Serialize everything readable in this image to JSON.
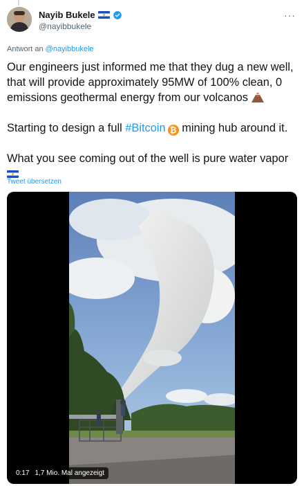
{
  "author": {
    "display_name": "Nayib Bukele",
    "handle": "@nayibbukele",
    "verified_icon": "verified-badge-icon",
    "flag_icon": "el-salvador-flag-icon"
  },
  "reply": {
    "prefix": "Antwort an",
    "target": "@nayibbukele"
  },
  "tweet": {
    "line1": "Our engineers just informed me that they dug a new well, that will provide approximately 95MW of 100% clean, 0 emissions geothermal energy from our volcanos",
    "line2_before": "Starting to design a full",
    "hashtag": "#Bitcoin",
    "line2_after": "mining hub around it.",
    "line3": "What you see coming out of the well is pure water vapor",
    "emoji_icons": [
      "volcano-icon",
      "bitcoin-icon",
      "el-salvador-flag-icon"
    ]
  },
  "translate_label": "Tweet übersetzen",
  "video": {
    "time": "0:17",
    "views": "1,7 Mio. Mal angezeigt"
  },
  "colors": {
    "link": "#1d9bf0",
    "text": "#0f1419",
    "secondary": "#536471"
  }
}
